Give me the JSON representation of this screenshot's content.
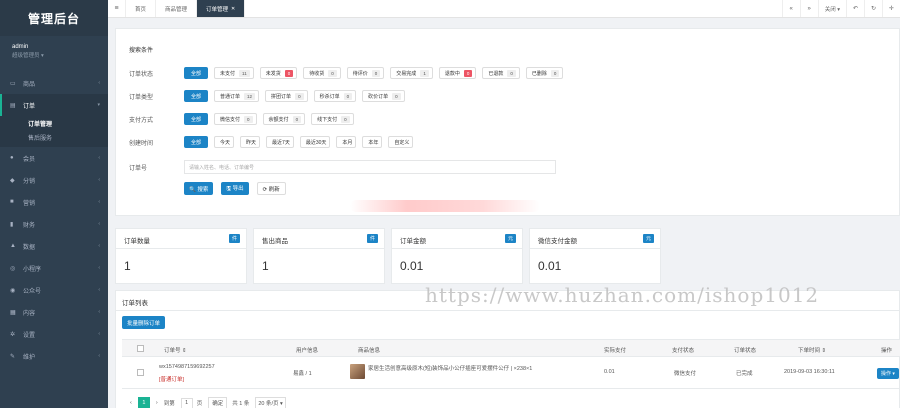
{
  "app": {
    "logo": "管理后台"
  },
  "user": {
    "name": "admin",
    "role": "超级管理员 ▾"
  },
  "sidebar": {
    "items": [
      {
        "icon": "monitor-icon",
        "glyph": "▭",
        "label": "商品"
      },
      {
        "icon": "file-icon",
        "glyph": "▤",
        "label": "订单",
        "active": true
      },
      {
        "icon": "person-icon",
        "glyph": "●",
        "label": "会员"
      },
      {
        "icon": "share-icon",
        "glyph": "◆",
        "label": "分销"
      },
      {
        "icon": "marketing-icon",
        "glyph": "■",
        "label": "营销"
      },
      {
        "icon": "finance-icon",
        "glyph": "▮",
        "label": "财务"
      },
      {
        "icon": "chart-icon",
        "glyph": "▲",
        "label": "数据"
      },
      {
        "icon": "applet-icon",
        "glyph": "◎",
        "label": "小程序"
      },
      {
        "icon": "wechat-icon",
        "glyph": "◉",
        "label": "公众号"
      },
      {
        "icon": "content-icon",
        "glyph": "▦",
        "label": "内容"
      },
      {
        "icon": "gear-icon",
        "glyph": "✲",
        "label": "设置"
      },
      {
        "icon": "wrench-icon",
        "glyph": "✎",
        "label": "维护"
      }
    ],
    "order_sub": [
      "订单管理",
      "售后服务"
    ]
  },
  "tabs": {
    "items": [
      {
        "label": "首页",
        "close": ""
      },
      {
        "label": "商品管理",
        "close": ""
      },
      {
        "label": "订单管理",
        "close": "✕"
      }
    ],
    "close_label": "关闭 ▾"
  },
  "search": {
    "title": "搜索条件",
    "status_label": "订单状态",
    "status": [
      {
        "label": "全部",
        "count": ""
      },
      {
        "label": "未支付",
        "count": "11"
      },
      {
        "label": "未发货",
        "count": "0",
        "red": true
      },
      {
        "label": "待收货",
        "count": "0"
      },
      {
        "label": "待评价",
        "count": "0"
      },
      {
        "label": "交易完成",
        "count": "1"
      },
      {
        "label": "退款中",
        "count": "0",
        "red": true
      },
      {
        "label": "已退款",
        "count": "0"
      },
      {
        "label": "已删除",
        "count": "0"
      }
    ],
    "type_label": "订单类型",
    "types": [
      {
        "label": "全部",
        "count": ""
      },
      {
        "label": "普通订单",
        "count": "12"
      },
      {
        "label": "拼团订单",
        "count": "0"
      },
      {
        "label": "秒杀订单",
        "count": "0"
      },
      {
        "label": "砍价订单",
        "count": "0"
      }
    ],
    "pay_label": "支付方式",
    "pays": [
      {
        "label": "全部",
        "count": ""
      },
      {
        "label": "微信支付",
        "count": "0"
      },
      {
        "label": "余额支付",
        "count": "0"
      },
      {
        "label": "线下支付",
        "count": "0"
      }
    ],
    "time_label": "创建时间",
    "times": [
      "全部",
      "今天",
      "昨天",
      "最近7天",
      "最近30天",
      "本月",
      "本年",
      "自定义"
    ],
    "order_no_label": "订单号",
    "order_no_placeholder": "请输入姓名、电话、订单编号",
    "search_btn": "🔍 搜索",
    "export_btn": "🖫 导出",
    "refresh_btn": "⟳ 刷新"
  },
  "stats": [
    {
      "title": "订单数量",
      "badge": "件",
      "value": "1"
    },
    {
      "title": "售出商品",
      "badge": "件",
      "value": "1"
    },
    {
      "title": "订单金额",
      "badge": "元",
      "value": "0.01"
    },
    {
      "title": "微信支付金额",
      "badge": "元",
      "value": "0.01"
    }
  ],
  "orders": {
    "title": "订单列表",
    "merge_btn": "批量删除订单",
    "columns": [
      "订单号 ⇕",
      "用户信息",
      "商品信息",
      "实际支付",
      "支付状态",
      "订单状态",
      "下单时间 ⇕",
      "操作"
    ],
    "rows": [
      {
        "order_no": "wx1574987159692257",
        "order_tag": "[普通订单]",
        "user": "易鑫 / 1",
        "product": "家居生活创意高级原木(短)装饰品小公仔插座可爱摆件公仔 | ×238×1",
        "paid": "0.01",
        "pay_status": "微信支付",
        "order_status": "已完成",
        "time": "2019-09-03 16:30:11",
        "op": "操作 ▾"
      }
    ],
    "pager": {
      "prev": "‹",
      "current": "1",
      "next": "›",
      "goto_label": "到第",
      "page_input": "1",
      "page_unit": "页",
      "confirm": "确定",
      "total": "共 1 条",
      "per_page": "20 条/页 ▾"
    }
  },
  "watermark": "https://www.huzhan.com/ishop1012"
}
